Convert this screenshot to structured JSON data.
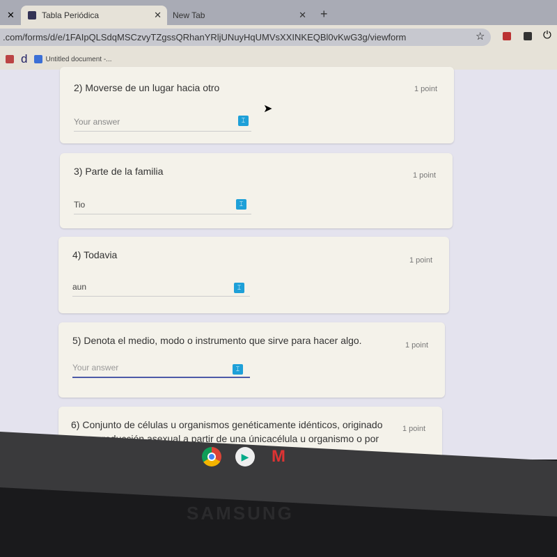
{
  "browser": {
    "tabs": [
      {
        "label": "Tabla Periódica",
        "active": true
      },
      {
        "label": "New Tab",
        "active": false
      }
    ],
    "url": ".com/forms/d/e/1FAIpQLSdqMSCzvyTZgssQRhanYRljUNuyHqUMVsXXINKEQBl0vKwG3g/viewform",
    "bookmarks": [
      {
        "label": "d"
      },
      {
        "label": "Untitled document -..."
      }
    ]
  },
  "questions": [
    {
      "title": "2) Moverse de un lugar hacia otro",
      "points": "1 point",
      "answer": "Your answer"
    },
    {
      "title": "3) Parte de la familia",
      "points": "1 point",
      "answer": "Tio"
    },
    {
      "title": "4) Todavia",
      "points": "1 point",
      "answer": "aun"
    },
    {
      "title": "5) Denota el medio, modo o instrumento que sirve para hacer algo.",
      "points": "1 point",
      "answer": "Your answer"
    },
    {
      "title": "6) Conjunto de células u organismos genéticamente idénticos, originado por reproducción asexual a partir de una únicacélula u organismo o por",
      "points": "1 point"
    }
  ],
  "shelf": {
    "apps": [
      "chrome",
      "play-store",
      "gmail"
    ]
  },
  "device": {
    "brand": "SAMSUNG"
  }
}
